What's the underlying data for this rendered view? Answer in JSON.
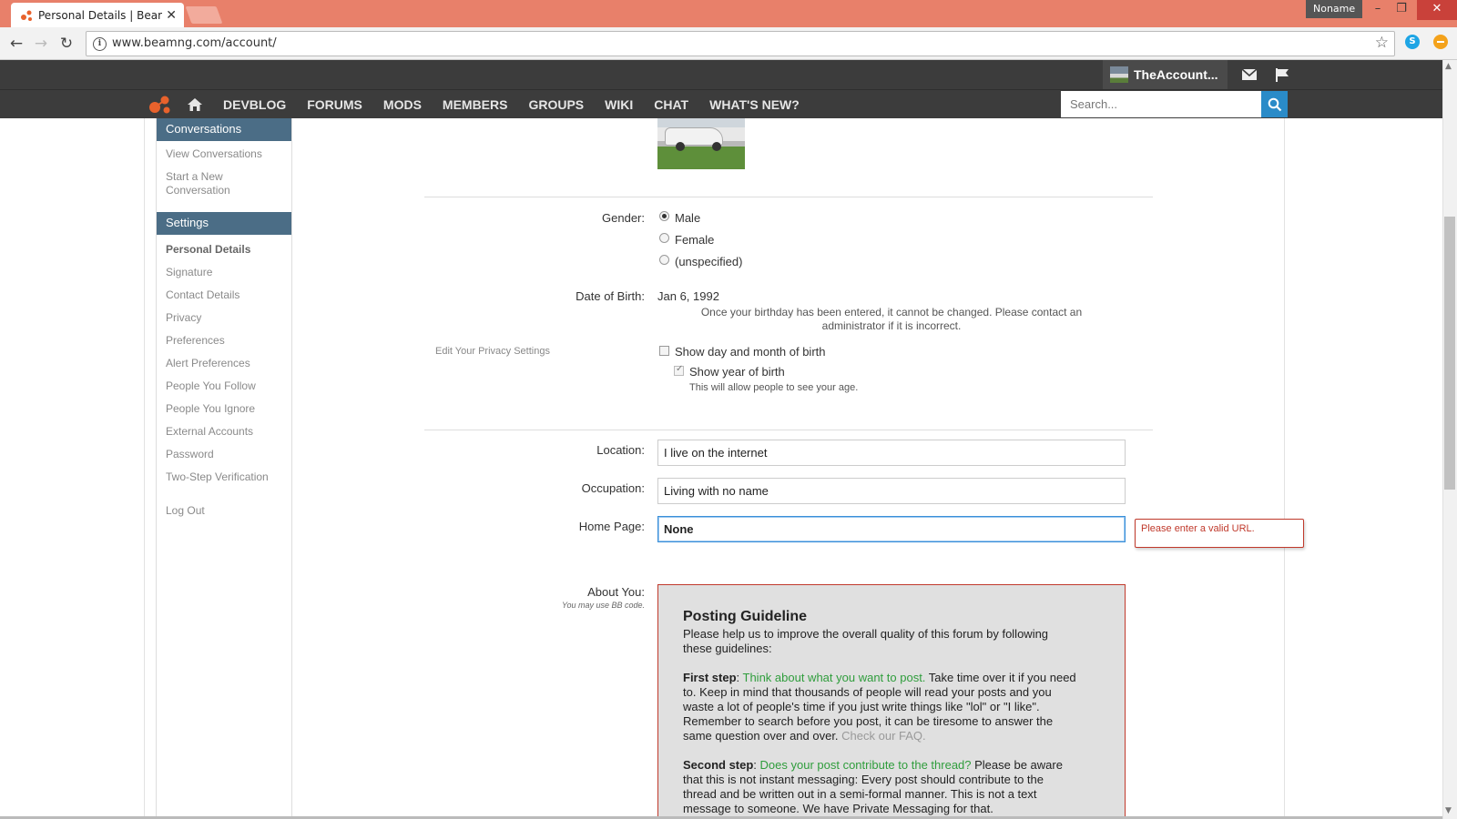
{
  "browser": {
    "tab_title": "Personal Details | BeamNG",
    "url": "www.beamng.com/account/",
    "profile_name": "Noname",
    "min_label": "–",
    "restore_label": "❐",
    "close_label": "✕"
  },
  "site": {
    "account_name": "TheAccount...",
    "nav": [
      "DEVBLOG",
      "FORUMS",
      "MODS",
      "MEMBERS",
      "GROUPS",
      "WIKI",
      "CHAT",
      "WHAT'S NEW?"
    ],
    "search_placeholder": "Search...",
    "accent_color": "#2a8bc8",
    "logo_color": "#e8622c"
  },
  "sidebar": {
    "conversations_header": "Conversations",
    "conversation_items": [
      "View Conversations",
      "Start a New",
      "Conversation"
    ],
    "settings_header": "Settings",
    "settings_items": [
      "Personal Details",
      "Signature",
      "Contact Details",
      "Privacy",
      "Preferences",
      "Alert Preferences",
      "People You Follow",
      "People You Ignore",
      "External Accounts",
      "Password",
      "Two-Step Verification"
    ],
    "logout": "Log Out"
  },
  "form": {
    "gender_label": "Gender:",
    "gender_options": [
      "Male",
      "Female",
      "(unspecified)"
    ],
    "gender_selected": "Male",
    "dob_label": "Date of Birth:",
    "dob_value": "Jan 6, 1992",
    "dob_note_line1": "Once your birthday has been entered, it cannot be changed. Please contact an",
    "dob_note_line2": "administrator if it is incorrect.",
    "privacy_link": "Edit Your Privacy Settings",
    "show_day_month": "Show day and month of birth",
    "show_year": "Show year of birth",
    "show_year_note": "This will allow people to see your age.",
    "location_label": "Location:",
    "location_value": "I live on the internet",
    "occupation_label": "Occupation:",
    "occupation_value": "Living with no name",
    "homepage_label": "Home Page:",
    "homepage_value": "None",
    "homepage_error": "Please enter a valid URL.",
    "about_label": "About You:",
    "about_note": "You may use BB code."
  },
  "guideline": {
    "title": "Posting Guideline",
    "intro_1": "Please help us to improve the overall quality of this forum by following",
    "intro_2": "these guidelines:",
    "first_label": "First step",
    "first_sep": ": ",
    "first_highlight": "Think about what you want to post.",
    "first_rest_1": " Take time over it if you need",
    "first_line_2": "to. Keep in mind that thousands of people will read your posts and you",
    "first_line_3": "waste a lot of people's time if you just write things like \"lol\" or \"I like\".",
    "first_line_4": "Remember to search before you post, it can be tiresome to answer the",
    "first_line_5": "same question over and over. ",
    "first_link": "Check our FAQ.",
    "second_label": "Second step",
    "second_sep": ": ",
    "second_highlight": "Does your post contribute to the thread?",
    "second_rest_1": " Please be aware",
    "second_line_2": "that this is not instant messaging: Every post should contribute to the",
    "second_line_3": "thread and be written out in a semi-formal manner. This is not a text",
    "second_line_4": "message to someone. We have Private Messaging for that."
  }
}
